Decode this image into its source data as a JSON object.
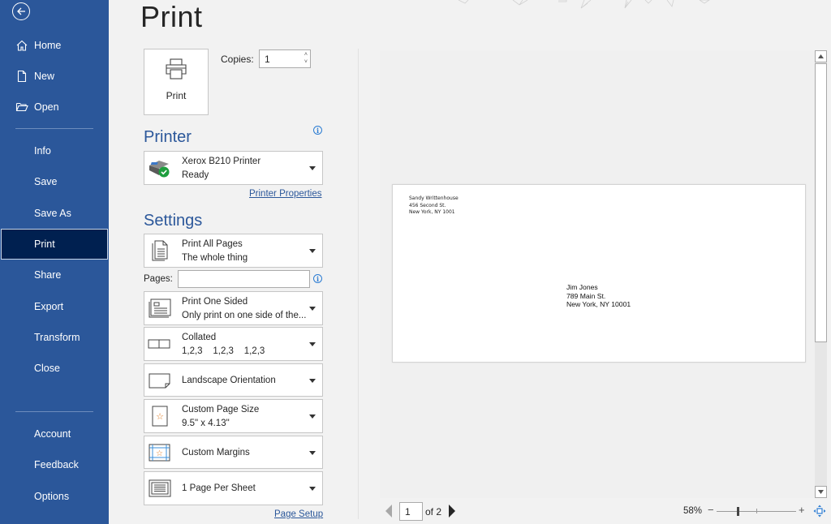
{
  "sidebar": {
    "back_icon": "back-arrow-icon",
    "items": [
      {
        "label": "Home",
        "icon": "home-icon"
      },
      {
        "label": "New",
        "icon": "new-document-icon"
      },
      {
        "label": "Open",
        "icon": "open-folder-icon"
      },
      {
        "label": "Info"
      },
      {
        "label": "Save"
      },
      {
        "label": "Save As"
      },
      {
        "label": "Print",
        "active": true
      },
      {
        "label": "Share"
      },
      {
        "label": "Export"
      },
      {
        "label": "Transform"
      },
      {
        "label": "Close"
      },
      {
        "label": "Account"
      },
      {
        "label": "Feedback"
      },
      {
        "label": "Options"
      }
    ],
    "colors": {
      "background": "#2b579a",
      "active": "#002050"
    }
  },
  "header": {
    "title": "Print"
  },
  "print_button": {
    "label": "Print",
    "icon": "printer-icon"
  },
  "copies": {
    "label": "Copies:",
    "value": "1"
  },
  "printer": {
    "heading": "Printer",
    "name": "Xerox B210 Printer",
    "status": "Ready",
    "properties_link": "Printer Properties"
  },
  "settings": {
    "heading": "Settings",
    "print_range": {
      "line1": "Print All Pages",
      "line2": "The whole thing"
    },
    "pages": {
      "label": "Pages:",
      "value": ""
    },
    "sides": {
      "line1": "Print One Sided",
      "line2": "Only print on one side of the..."
    },
    "collation": {
      "line1": "Collated",
      "line2": "1,2,3    1,2,3    1,2,3"
    },
    "orientation": {
      "line1": "Landscape Orientation"
    },
    "page_size": {
      "line1": "Custom Page Size",
      "line2": "9.5\" x 4.13\""
    },
    "margins": {
      "line1": "Custom Margins"
    },
    "pages_per_sheet": {
      "line1": "1 Page Per Sheet"
    },
    "page_setup_link": "Page Setup"
  },
  "preview": {
    "return_address": [
      "Sandy Writtenhouse",
      "456 Second St.",
      "New York, NY 1001"
    ],
    "recipient_address": [
      "Jim Jones",
      "789 Main St.",
      "New York, NY 10001"
    ]
  },
  "page_nav": {
    "current": "1",
    "of_label": "of 2"
  },
  "zoom": {
    "percent_label": "58%",
    "value_percent": 58,
    "minus": "−",
    "plus": "+"
  },
  "accent_color": "#2b579a"
}
